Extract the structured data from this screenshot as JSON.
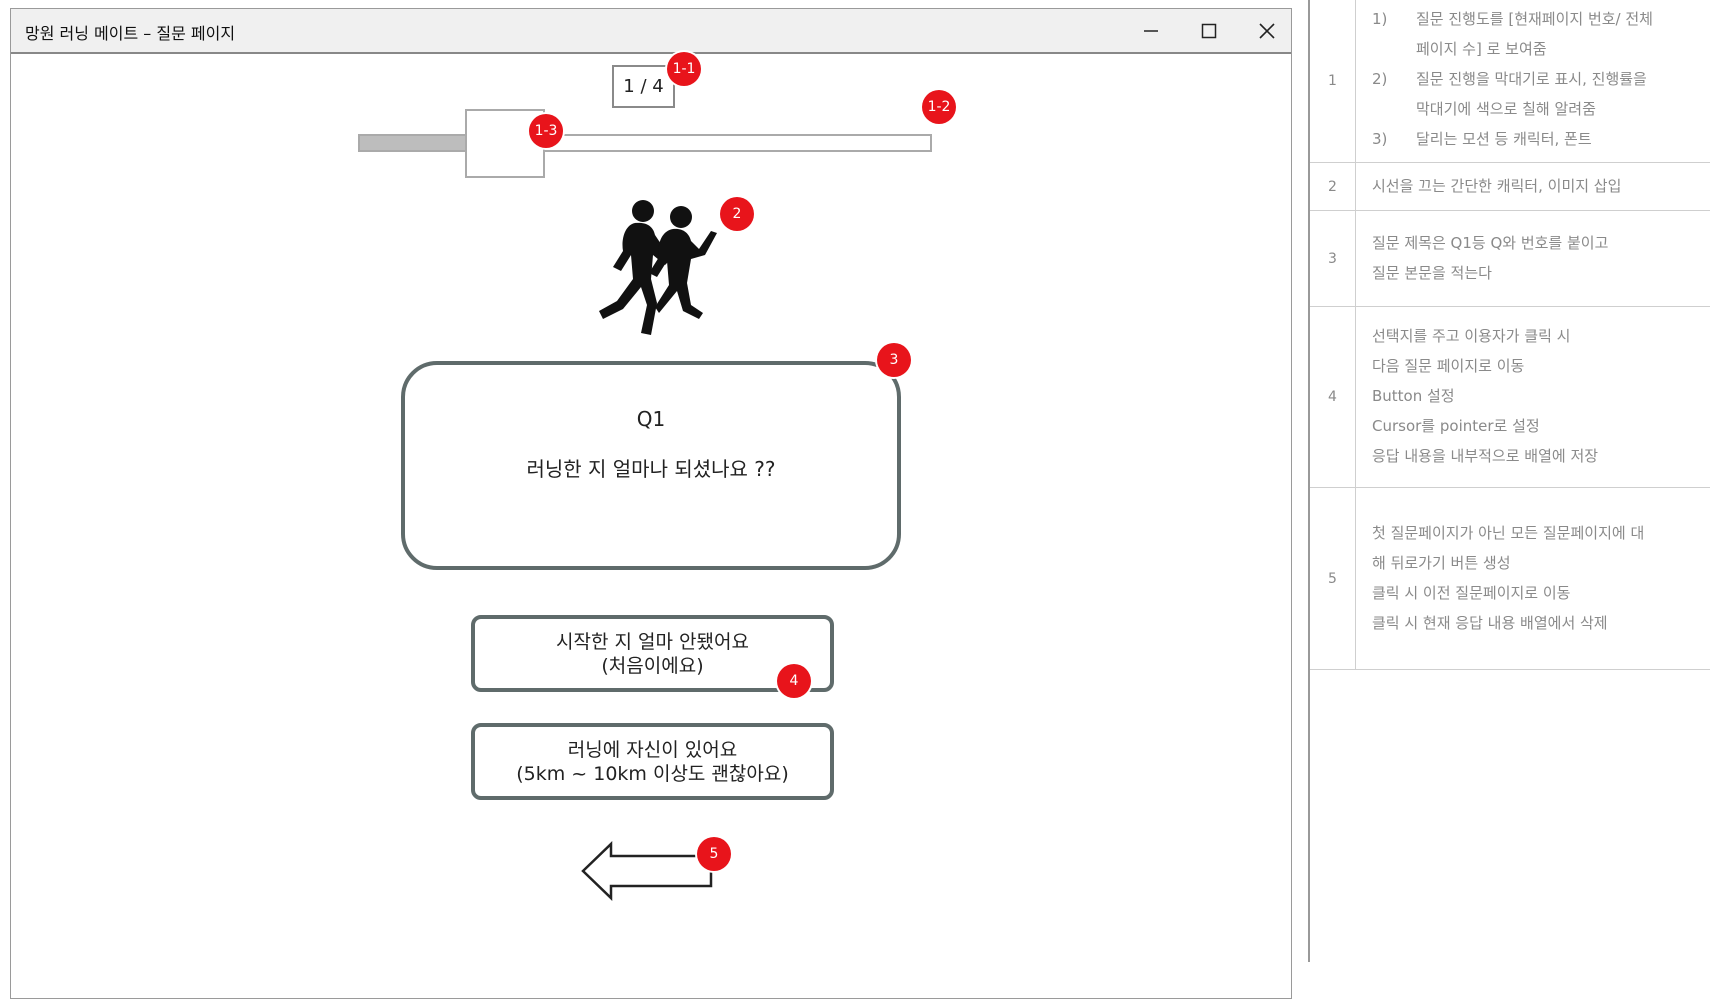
{
  "window": {
    "title": "망원 러닝 메이트 – 질문 페이지"
  },
  "progress": {
    "current": 1,
    "total": 4,
    "label": "1 / 4",
    "fill_fraction": 0.1875
  },
  "question": {
    "number": "Q1",
    "text": "러닝한 지 얼마나 되셨나요 ??"
  },
  "answers": [
    {
      "line1": "시작한 지 얼마 안됐어요",
      "line2": "(처음이에요)"
    },
    {
      "line1": "러닝에 자신이 있어요",
      "line2": "(5km ~ 10km 이상도 괜찮아요)"
    }
  ],
  "markers": {
    "m1_1": "1-1",
    "m1_2": "1-2",
    "m1_3": "1-3",
    "m2": "2",
    "m3": "3",
    "m4": "4",
    "m5": "5"
  },
  "notes": [
    {
      "num": "1",
      "items": [
        {
          "n": "1)",
          "lines": [
            "질문 진행도를 [현재페이지 번호/ 전체",
            "페이지 수] 로 보여줌"
          ]
        },
        {
          "n": "2)",
          "lines": [
            "질문 진행을 막대기로 표시, 진행률을",
            "막대기에 색으로 칠해 알려줌"
          ]
        },
        {
          "n": "3)",
          "lines": [
            "달리는 모션 등 캐릭터, 폰트"
          ]
        }
      ]
    },
    {
      "num": "2",
      "lines": [
        "시선을 끄는 간단한 캐릭터, 이미지 삽입"
      ]
    },
    {
      "num": "3",
      "lines": [
        "질문 제목은 Q1등 Q와 번호를 붙이고",
        "질문 본문을 적는다"
      ]
    },
    {
      "num": "4",
      "lines": [
        "선택지를 주고 이용자가 클릭 시",
        "다음 질문 페이지로 이동",
        "Button 설정",
        "Cursor를 pointer로 설정",
        "응답 내용을 내부적으로 배열에 저장"
      ]
    },
    {
      "num": "5",
      "lines": [
        "첫 질문페이지가 아닌 모든 질문페이지에 대",
        "해 뒤로가기 버튼 생성",
        "클릭 시 이전 질문페이지로 이동",
        "클릭 시 현재 응답 내용 배열에서 삭제"
      ]
    }
  ],
  "colors": {
    "marker": "#e8141b",
    "border": "#5f6b6b",
    "note_text": "#8a8a8a"
  }
}
